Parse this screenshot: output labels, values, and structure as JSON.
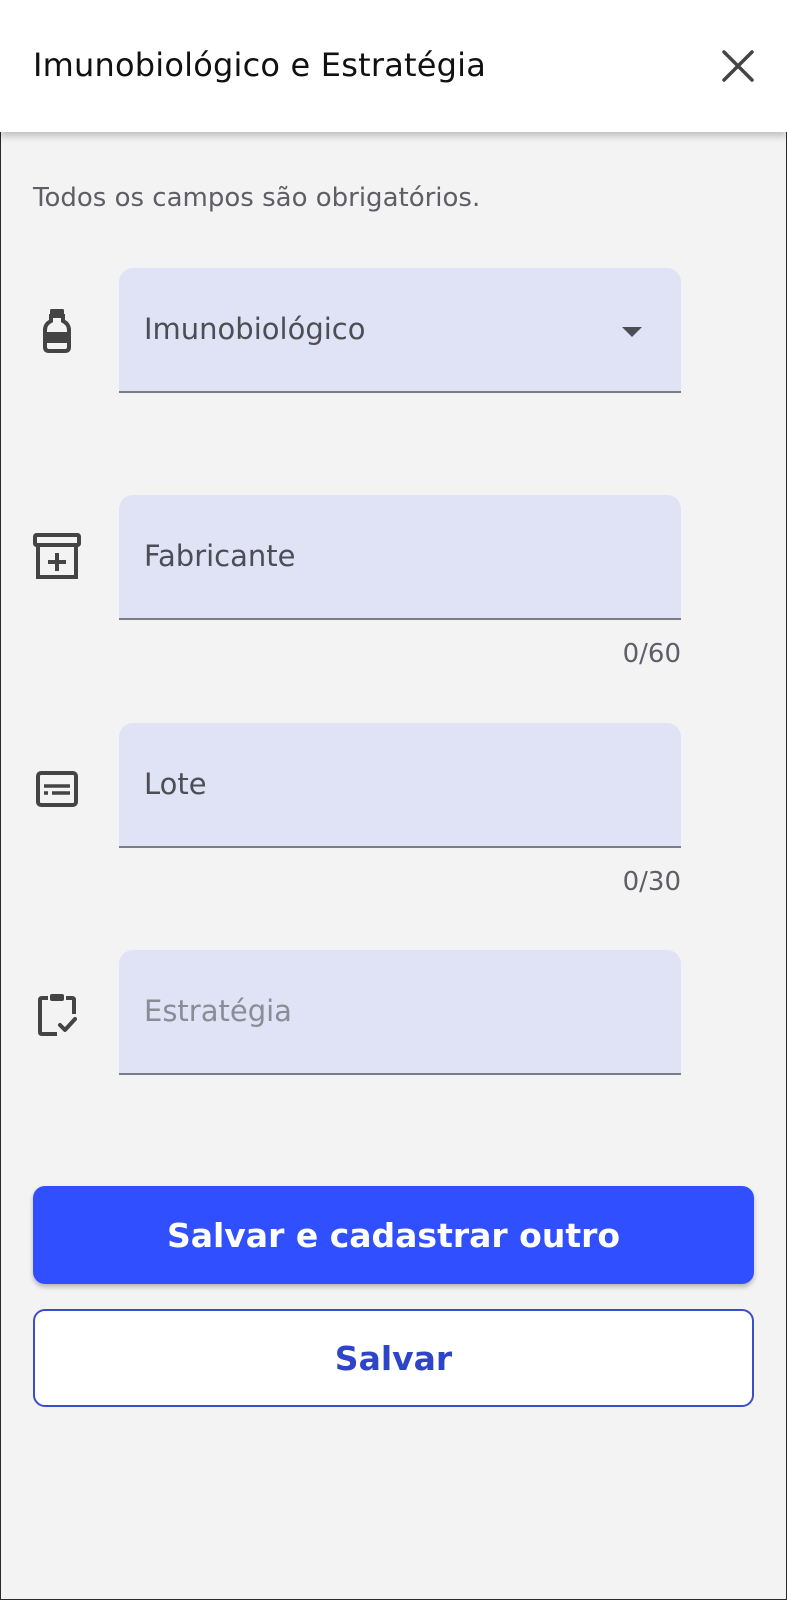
{
  "header": {
    "title": "Imunobiológico e Estratégia",
    "close_icon": "close-icon"
  },
  "form": {
    "note": "Todos os campos são obrigatórios.",
    "imunobiologico": {
      "value": "Imunobiológico",
      "icon": "vaccine-bottle-icon",
      "type": "select"
    },
    "fabricante": {
      "value": "Fabricante",
      "counter": "0/60",
      "icon": "box-add-icon"
    },
    "lote": {
      "value": "Lote",
      "counter": "0/30",
      "icon": "subtitles-icon"
    },
    "estrategia": {
      "placeholder": "Estratégia",
      "icon": "clipboard-check-icon"
    }
  },
  "actions": {
    "save_and_new": "Salvar e cadastrar outro",
    "save": "Salvar"
  },
  "colors": {
    "primary": "#304ffe",
    "field_bg": "#e0e2f5",
    "page_bg": "#f3f3f4"
  }
}
